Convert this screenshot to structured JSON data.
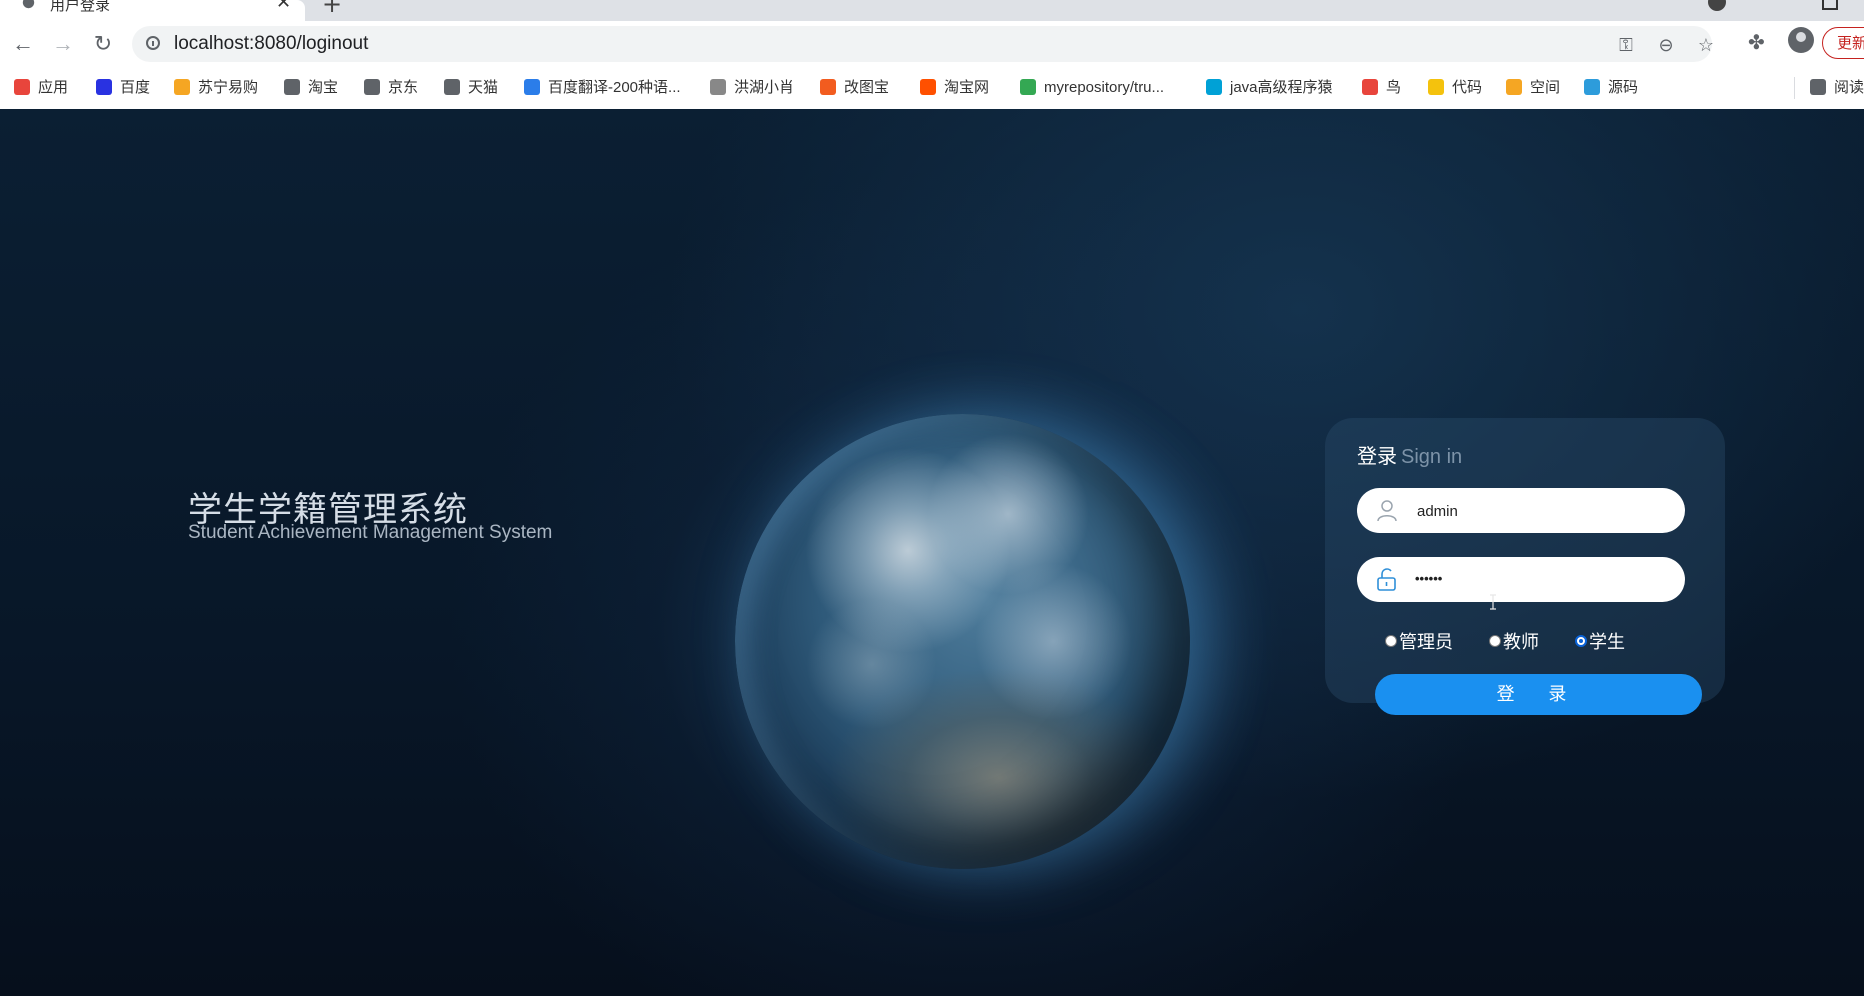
{
  "browser": {
    "tab_title": "用户登录",
    "url": "localhost:8080/loginout",
    "update_label": "更新",
    "reading_list_label": "阅读"
  },
  "bookmarks": [
    {
      "label": "应用",
      "color": "#e8453c"
    },
    {
      "label": "百度",
      "color": "#2932e1"
    },
    {
      "label": "苏宁易购",
      "color": "#f5a623"
    },
    {
      "label": "淘宝",
      "color": "#5f6368"
    },
    {
      "label": "京东",
      "color": "#5f6368"
    },
    {
      "label": "天猫",
      "color": "#5f6368"
    },
    {
      "label": "百度翻译-200种语...",
      "color": "#2b7de9"
    },
    {
      "label": "洪湖小肖",
      "color": "#888888"
    },
    {
      "label": "改图宝",
      "color": "#f25c1f"
    },
    {
      "label": "淘宝网",
      "color": "#ff5000"
    },
    {
      "label": "myrepository/tru...",
      "color": "#34a853"
    },
    {
      "label": "java高级程序猿",
      "color": "#00a1d6"
    },
    {
      "label": "鸟",
      "color": "#e8453c"
    },
    {
      "label": "代码",
      "color": "#f4c20d"
    },
    {
      "label": "空间",
      "color": "#f5a623"
    },
    {
      "label": "源码",
      "color": "#2d9cdb"
    }
  ],
  "page": {
    "title_cn": "学生学籍管理系统",
    "title_en": "Student Achievement Management System"
  },
  "login": {
    "heading": "登录",
    "heading_sub": "Sign in",
    "username_value": "admin",
    "password_value": "••••••",
    "roles": [
      {
        "label": "管理员",
        "checked": false
      },
      {
        "label": "教师",
        "checked": false
      },
      {
        "label": "学生",
        "checked": true
      }
    ],
    "button_label": "登 录"
  },
  "colors": {
    "accent": "#1a90f0",
    "background": "#0b1a2b"
  }
}
